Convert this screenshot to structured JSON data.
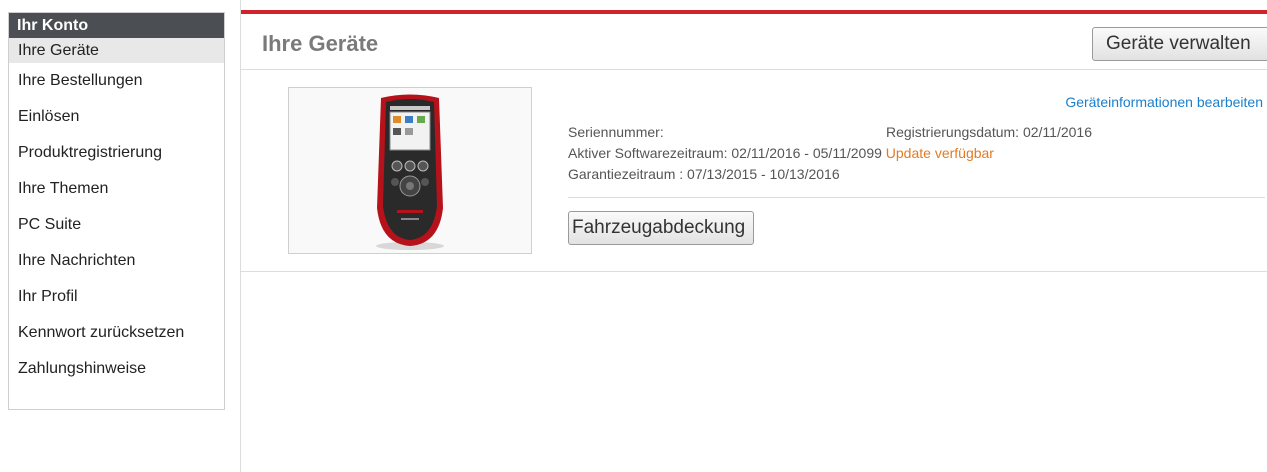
{
  "sidebar": {
    "header": "Ihr Konto",
    "items": [
      {
        "label": "Ihre Geräte"
      },
      {
        "label": "Ihre Bestellungen"
      },
      {
        "label": "Einlösen"
      },
      {
        "label": "Produktregistrierung"
      },
      {
        "label": "Ihre Themen"
      },
      {
        "label": "PC Suite"
      },
      {
        "label": "Ihre Nachrichten"
      },
      {
        "label": "Ihr Profil"
      },
      {
        "label": "Kennwort zurücksetzen"
      },
      {
        "label": "Zahlungshinweise"
      }
    ]
  },
  "main": {
    "title": "Ihre Geräte",
    "manage_button": "Geräte verwalten",
    "device": {
      "edit_link": "Geräteinformationen bearbeiten",
      "serial_label": "Seriennummer:",
      "registration": "Registrierungsdatum: 02/11/2016",
      "software_period": "Aktiver Softwarezeitraum: 02/11/2016 - 05/11/2099",
      "update_text": "Update verfügbar",
      "warranty": "Garantiezeitraum : 07/13/2015 - 10/13/2016",
      "coverage_button": "Fahrzeugabdeckung"
    }
  },
  "colors": {
    "accent_red": "#d0232b",
    "link_blue": "#1b7fcc",
    "update_orange": "#e27b22",
    "sidebar_header": "#4b4e52"
  }
}
